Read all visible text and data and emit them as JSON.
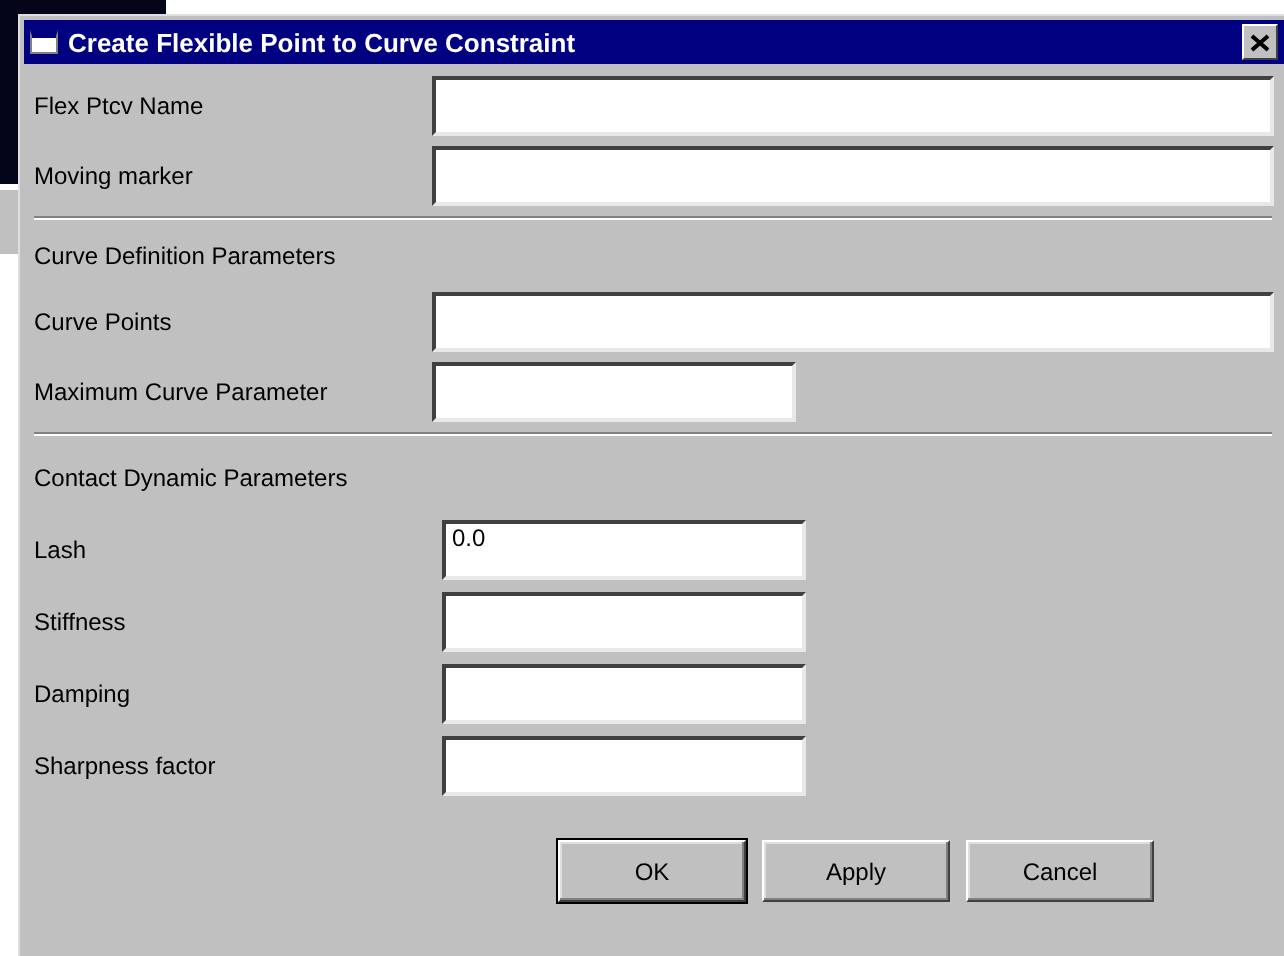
{
  "window": {
    "title": "Create Flexible Point to Curve Constraint"
  },
  "sections": [
    {
      "fields": [
        {
          "label": "Flex Ptcv Name",
          "kind": "long"
        },
        {
          "label": "Moving marker",
          "kind": "long"
        }
      ]
    },
    {
      "heading": "Curve Definition Parameters",
      "fields": [
        {
          "label": "Curve Points",
          "kind": "long"
        },
        {
          "label": "Maximum Curve Parameter",
          "kind": "short"
        }
      ]
    },
    {
      "heading": "Contact Dynamic Parameters",
      "fields": [
        {
          "label": "Lash",
          "kind": "short",
          "value": "0.0"
        },
        {
          "label": "Stiffness",
          "kind": "short"
        },
        {
          "label": "Damping",
          "kind": "short"
        },
        {
          "label": "Sharpness factor",
          "kind": "short"
        }
      ]
    }
  ],
  "buttons": [
    {
      "label": "OK",
      "default": true
    },
    {
      "label": "Apply",
      "default": false
    },
    {
      "label": "Cancel",
      "default": false
    }
  ]
}
